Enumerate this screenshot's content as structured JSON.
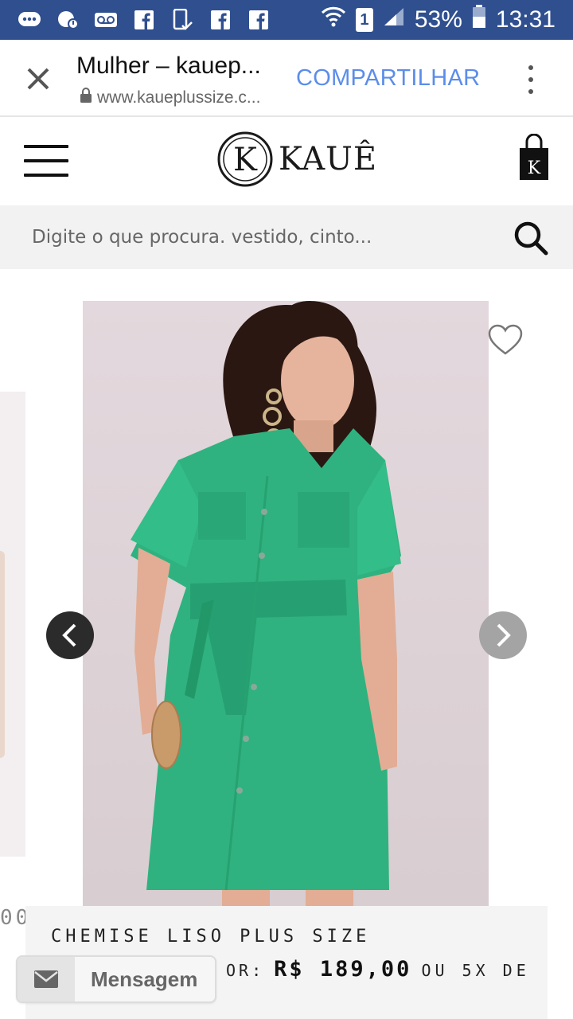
{
  "status_bar": {
    "icons": [
      "chat-bubbles-icon",
      "chat-notification-icon",
      "voicemail-icon",
      "facebook-icon",
      "phone-check-icon",
      "facebook-icon",
      "facebook-icon"
    ],
    "sim_label": "1",
    "battery": "53%",
    "time": "13:31"
  },
  "toolbar": {
    "title": "Mulher – kauep...",
    "url": "www.kaueplussize.c...",
    "share_label": "COMPARTILHAR"
  },
  "header": {
    "logo_text": "KAUÊ",
    "logo_monogram": "K",
    "bag_letter": "K"
  },
  "search": {
    "placeholder": "Digite o que procura. vestido, cinto..."
  },
  "carousel": {
    "side_price_fragment": "00"
  },
  "product": {
    "name": "CHEMISE LISO PLUS SIZE",
    "price_label": "OR:",
    "price_value": "R$ 189,00",
    "installments": "OU 5X DE"
  },
  "message_button": {
    "label": "Mensagem"
  },
  "colors": {
    "status_bar": "#2f4f8f",
    "share_link": "#5b8dea",
    "dress": "#2fb27f",
    "background_search": "#f2f2f2"
  }
}
